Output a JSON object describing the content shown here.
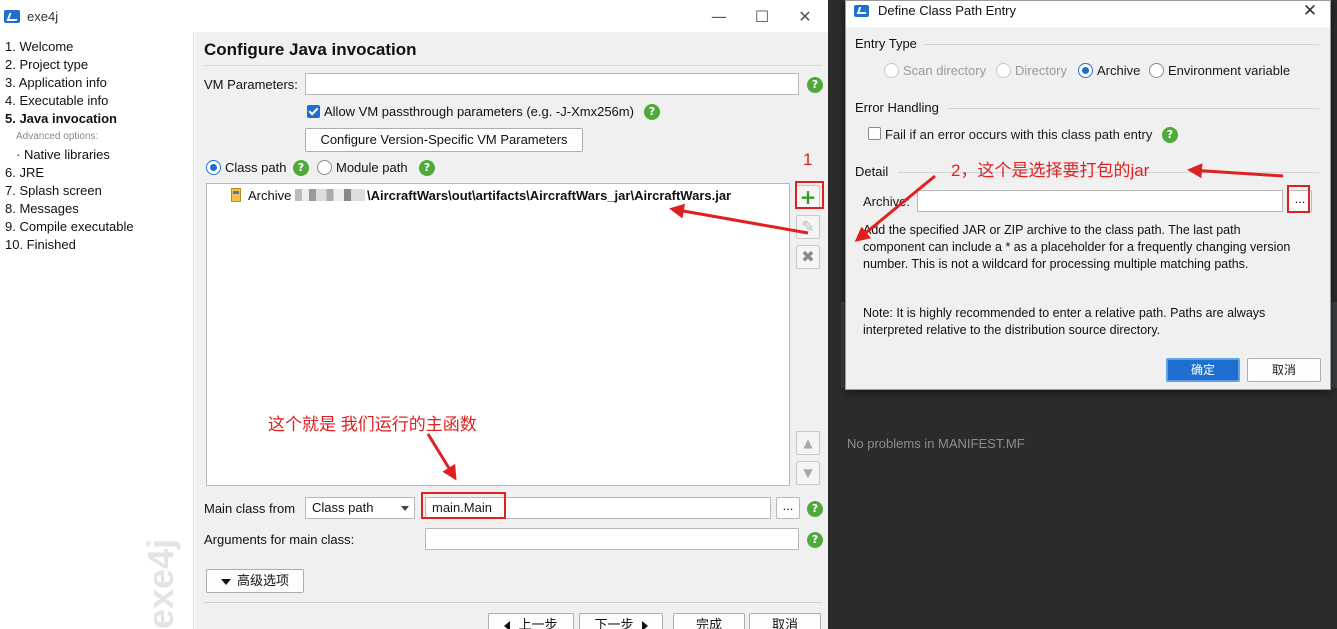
{
  "main_window": {
    "title": "exe4j",
    "minimize_glyph": "—",
    "maximize_glyph": "☐",
    "close_glyph": "✕"
  },
  "steps": [
    {
      "label": "1. Welcome"
    },
    {
      "label": "2. Project type"
    },
    {
      "label": "3. Application info"
    },
    {
      "label": "4. Executable info"
    },
    {
      "label": "5. Java invocation",
      "active": true
    },
    {
      "label": "Advanced options:"
    },
    {
      "label": "· Native libraries"
    },
    {
      "label": "6. JRE"
    },
    {
      "label": "7. Splash screen"
    },
    {
      "label": "8. Messages"
    },
    {
      "label": "9. Compile executable"
    },
    {
      "label": "10. Finished"
    }
  ],
  "watermark": "exe4j",
  "page": {
    "title": "Configure Java invocation",
    "vm_parameters_label": "VM Parameters:",
    "vm_parameters_value": "",
    "allow_passthrough_label": "Allow VM passthrough parameters (e.g. -J-Xmx256m)",
    "configure_version_button": "Configure Version-Specific VM Parameters",
    "class_path_label": "Class path",
    "module_path_label": "Module path",
    "classpath_entries": [
      {
        "prefix": "Archive",
        "path": "\\AircraftWars\\out\\artifacts\\AircraftWars_jar\\AircraftWars.jar"
      }
    ],
    "main_class_from_label": "Main class from",
    "main_class_source": "Class path",
    "main_class_value": "main.Main",
    "arguments_label": "Arguments for main class:",
    "arguments_value": "",
    "dots": "...",
    "advanced_button": "高级选项",
    "back_button": "上一步",
    "next_button": "下一步",
    "finish_button": "完成",
    "cancel_button": "取消",
    "help_glyph": "?",
    "add_glyph": "+",
    "edit_glyph": "✎",
    "remove_glyph": "✖",
    "up_glyph": "▲",
    "down_glyph": "▼"
  },
  "dialog": {
    "title": "Define Class Path Entry",
    "close_glyph": "✕",
    "entry_type_title": "Entry Type",
    "entry_types": [
      "Scan directory",
      "Directory",
      "Archive",
      "Environment variable"
    ],
    "selected_entry_type": "Archive",
    "error_handling_title": "Error Handling",
    "fail_label": "Fail if an error occurs with this class path entry",
    "detail_title": "Detail",
    "archive_label": "Archive:",
    "archive_value": "",
    "dots": "...",
    "description": "Add the specified JAR or ZIP archive to the class path. The last path component can include a * as a placeholder for a frequently changing version number. This is not a wildcard for processing multiple matching paths.",
    "note": "Note: It is highly recommended to enter a relative path. Paths are always interpreted relative to the distribution source directory.",
    "ok_button": "确定",
    "cancel_button": "取消"
  },
  "background": {
    "manifest_status": "No problems in MANIFEST.MF"
  },
  "annotations": {
    "label_1": "1",
    "label_2": "2，这个是选择要打包的jar",
    "label_main": "这个就是 我们运行的主函数",
    "color": "#e02020"
  }
}
